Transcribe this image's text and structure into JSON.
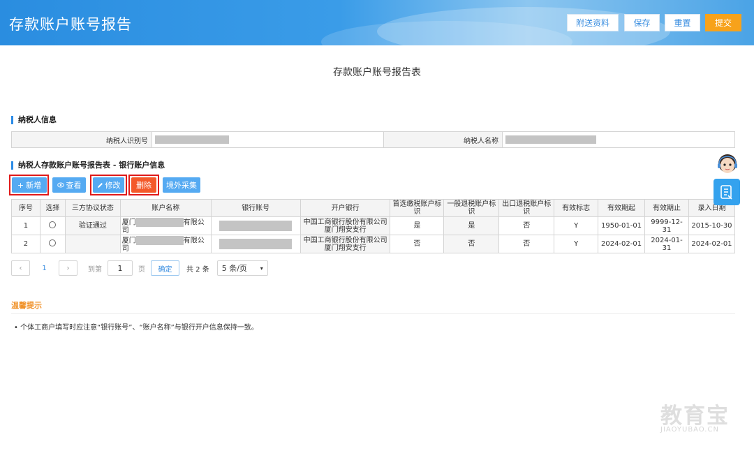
{
  "header": {
    "title": "存款账户账号报告",
    "buttons": {
      "attach": "附送资料",
      "save": "保存",
      "reset": "重置",
      "submit": "提交"
    }
  },
  "page_title": "存款账户账号报告表",
  "taxpayer": {
    "section_title": "纳税人信息",
    "id_label": "纳税人识别号",
    "name_label": "纳税人名称"
  },
  "bank": {
    "section_title": "纳税人存款账户账号报告表 - 银行账户信息",
    "toolbar": {
      "add": "新增",
      "view": "查看",
      "edit": "修改",
      "delete": "删除",
      "overseas": "境外采集"
    },
    "columns": [
      "序号",
      "选择",
      "三方协议状态",
      "账户名称",
      "银行账号",
      "开户银行",
      "首选缴税账户标识",
      "一般退税账户标识",
      "出口退税账户标识",
      "有效标志",
      "有效期起",
      "有效期止",
      "录入日期"
    ],
    "rows": [
      {
        "seq": "1",
        "status": "验证通过",
        "name_prefix": "厦门",
        "name_suffix": "有限公司",
        "bank": "中国工商银行股份有限公司厦门翔安支行",
        "first_tax": "是",
        "general_refund": "是",
        "export_refund": "否",
        "valid": "Y",
        "start": "1950-01-01",
        "end": "9999-12-31",
        "entry": "2015-10-30"
      },
      {
        "seq": "2",
        "status": "",
        "name_prefix": "厦门",
        "name_suffix": "有限公司",
        "bank": "中国工商银行股份有限公司厦门翔安支行",
        "first_tax": "否",
        "general_refund": "否",
        "export_refund": "否",
        "valid": "Y",
        "start": "2024-02-01",
        "end": "2024-01-31",
        "entry": "2024-02-01"
      }
    ]
  },
  "pager": {
    "current": "1",
    "goto_label": "到第",
    "goto_value": "1",
    "page_unit": "页",
    "confirm": "确定",
    "total": "共 2 条",
    "page_size": "5 条/页"
  },
  "tips": {
    "title": "温馨提示",
    "items": [
      "个体工商户填写时应注意“银行账号”、“账户名称”与银行开户信息保持一致。"
    ]
  },
  "watermark": {
    "big": "教育宝",
    "small": "JIAOYUBAO.CN"
  },
  "colors": {
    "primary": "#3a8ee0",
    "submit": "#f7a21b",
    "delete": "#f4592a",
    "highlight": "#e01919",
    "tip": "#f0922a"
  }
}
